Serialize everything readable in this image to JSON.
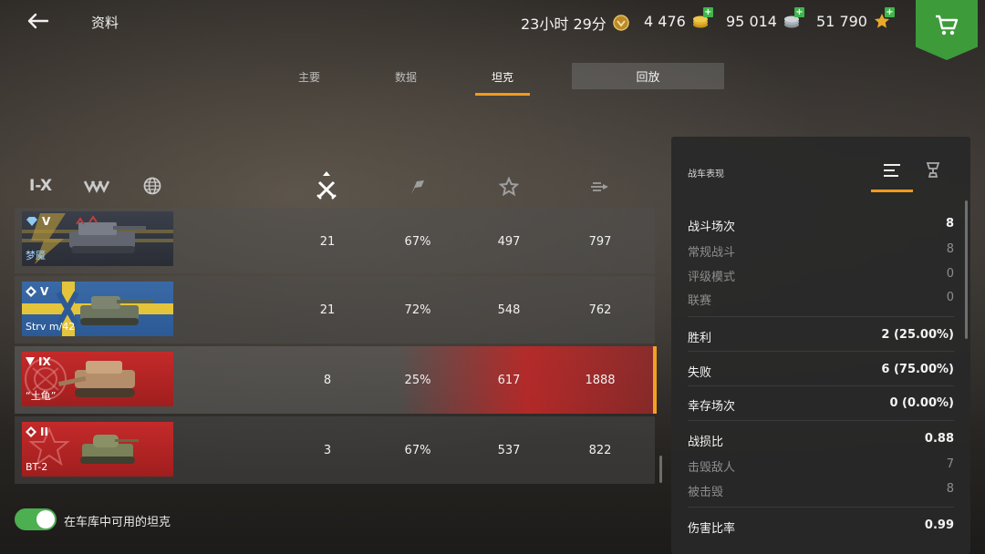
{
  "header": {
    "title": "资料",
    "timer": "23小时 29分",
    "gold": "4 476",
    "silver": "95 014",
    "free_xp": "51 790"
  },
  "tabs": [
    {
      "label": "主要"
    },
    {
      "label": "数据"
    },
    {
      "label": "坦克"
    },
    {
      "label": "回放"
    }
  ],
  "active_tab": "坦克",
  "filters": {
    "tier_label": "I-X"
  },
  "tanks": [
    {
      "tier": "V",
      "name": "梦魇",
      "battles": "21",
      "winrate": "67%",
      "xp": "497",
      "damage": "797",
      "selected": false
    },
    {
      "tier": "V",
      "name": "Strv m/42",
      "battles": "21",
      "winrate": "72%",
      "xp": "548",
      "damage": "762",
      "selected": false
    },
    {
      "tier": "IX",
      "name": "“土龟”",
      "battles": "8",
      "winrate": "25%",
      "xp": "617",
      "damage": "1888",
      "selected": true
    },
    {
      "tier": "II",
      "name": "BT-2",
      "battles": "3",
      "winrate": "67%",
      "xp": "537",
      "damage": "822",
      "selected": false
    }
  ],
  "toggle": {
    "label": "在车库中可用的坦克",
    "on": true
  },
  "panel": {
    "title": "战车表现",
    "stats": [
      {
        "label": "战斗场次",
        "value": "8",
        "kind": "main"
      },
      {
        "label": "常规战斗",
        "value": "8",
        "kind": "sub"
      },
      {
        "label": "评级模式",
        "value": "0",
        "kind": "sub"
      },
      {
        "label": "联赛",
        "value": "0",
        "kind": "sub"
      },
      {
        "label": "胜利",
        "value": "2 (25.00%)",
        "kind": "main"
      },
      {
        "label": "失败",
        "value": "6 (75.00%)",
        "kind": "main"
      },
      {
        "label": "幸存场次",
        "value": "0 (0.00%)",
        "kind": "main"
      },
      {
        "label": "战损比",
        "value": "0.88",
        "kind": "main"
      },
      {
        "label": "击毁敌人",
        "value": "7",
        "kind": "sub"
      },
      {
        "label": "被击毁",
        "value": "8",
        "kind": "sub"
      },
      {
        "label": "伤害比率",
        "value": "0.99",
        "kind": "main"
      }
    ]
  },
  "colors": {
    "accent": "#f29a1c",
    "plus_green": "#3fb54b",
    "shop_green": "#3d9b3a",
    "selected_red": "#c82828",
    "toggle_green": "#4caf50"
  }
}
